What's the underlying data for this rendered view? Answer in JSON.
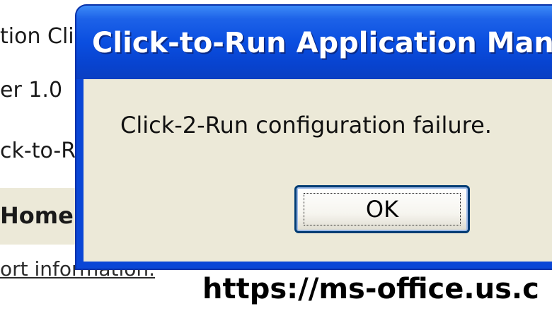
{
  "background": {
    "line_1": "tion Clie",
    "line_2": "er 1.0",
    "line_3": "ck-to-R",
    "home_label": "Home",
    "support_link": "ort information."
  },
  "dialog": {
    "title": "Click-to-Run Application Mana",
    "message": "Click-2-Run configuration failure.",
    "ok_label": "OK"
  },
  "watermark": {
    "text": "https://ms-office.us.c"
  },
  "colors": {
    "titlebar": "#0a4ee0",
    "dialog_body": "#ece9d8",
    "button_border": "#003c74"
  }
}
